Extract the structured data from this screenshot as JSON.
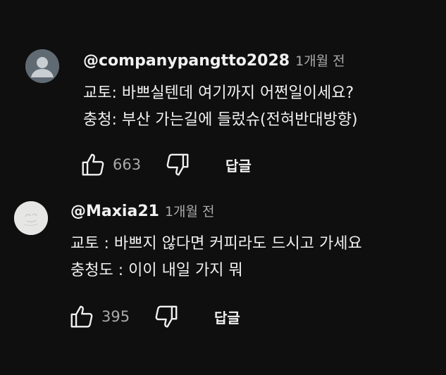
{
  "comments": [
    {
      "author": "@companypangtto2028",
      "time": "1개월 전",
      "lines": [
        "교토: 바쁘실텐데 여기까지 어쩐일이세요?",
        "충청: 부산 가는길에 들렀슈(전혀반대방향)"
      ],
      "likes": "663",
      "reply_label": "답글",
      "avatar_color": "#5f6a73"
    },
    {
      "author": "@Maxia21",
      "time": "1개월 전",
      "lines": [
        "교토 : 바쁘지 않다면 커피라도 드시고 가세요",
        "충청도 : 이이 내일 가지 뭐"
      ],
      "likes": "395",
      "reply_label": "답글",
      "avatar_color": "#e6e6e4"
    }
  ],
  "icons": {
    "like": "thumbs-up-icon",
    "dislike": "thumbs-down-icon"
  },
  "colors": {
    "background": "#0f0f0f",
    "text": "#f1f1f1",
    "secondary_text": "#aaaaaa"
  }
}
